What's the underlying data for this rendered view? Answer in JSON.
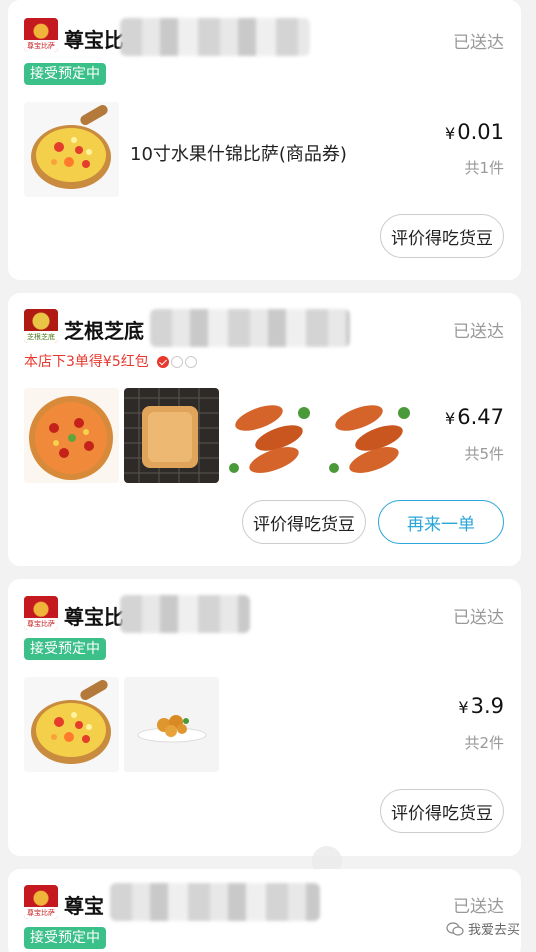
{
  "orders": [
    {
      "store_name": "尊宝比",
      "logo_text": "尊宝比萨",
      "status": "已送达",
      "tag": "接受预定中",
      "product_name": "10寸水果什锦比萨(商品券)",
      "currency": "¥",
      "price": "0.01",
      "count": "共1件",
      "buttons": [
        "评价得吃货豆"
      ]
    },
    {
      "store_name": "芝根芝底",
      "logo_text": "芝根芝底",
      "status": "已送达",
      "promo": "本店下3单得¥5红包",
      "promo_progress": 1,
      "promo_total": 3,
      "currency": "¥",
      "price": "6.47",
      "count": "共5件",
      "buttons": [
        "评价得吃货豆",
        "再来一单"
      ]
    },
    {
      "store_name": "尊宝比",
      "logo_text": "尊宝比萨",
      "status": "已送达",
      "tag": "接受预定中",
      "currency": "¥",
      "price": "3.9",
      "count": "共2件",
      "buttons": [
        "评价得吃货豆"
      ]
    },
    {
      "store_name": "尊宝",
      "logo_text": "尊宝比萨",
      "status": "已送达",
      "tag": "接受预定中"
    }
  ],
  "watermark": "我爱去买",
  "colors": {
    "accent_green": "#3cc089",
    "promo_red": "#e8382e",
    "primary_blue": "#2aa6d8",
    "status_gray": "#999999"
  }
}
